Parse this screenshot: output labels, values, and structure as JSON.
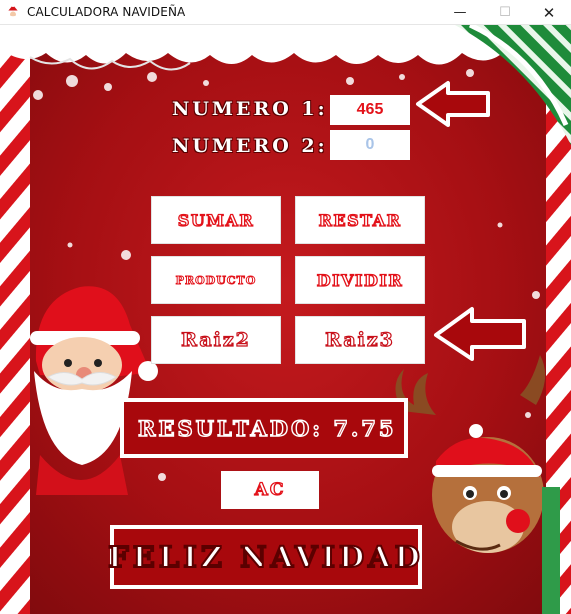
{
  "window": {
    "title": "CALCULADORA NAVIDEÑA",
    "minimize_glyph": "—",
    "maximize_glyph": "☐",
    "close_glyph": "✕"
  },
  "inputs": {
    "numero1_label": "NUMERO 1:",
    "numero1_value": "465",
    "numero2_label": "NUMERO 2:",
    "numero2_value": "0"
  },
  "buttons": {
    "sumar": "SUMAR",
    "restar": "RESTAR",
    "producto": "PRODUCTO",
    "dividir": "DIVIDIR",
    "raiz2": "Raiz2",
    "raiz3": "Raiz3",
    "ac": "AC"
  },
  "result": {
    "text": "RESULTADO: 7.75"
  },
  "banner": {
    "text": "FELIZ NAVIDAD"
  },
  "icons": [
    "santa-app-icon",
    "arrow-left-icon",
    "arrow-left-icon",
    "santa-illustration",
    "reindeer-illustration",
    "candy-cane-border",
    "snowflake-icon"
  ],
  "colors": {
    "background_red": "#b8141a",
    "accent_red": "#e3121a",
    "input_placeholder_blue": "#a9c4e8",
    "white": "#ffffff",
    "ribbon_green": "#1e8b3a"
  }
}
